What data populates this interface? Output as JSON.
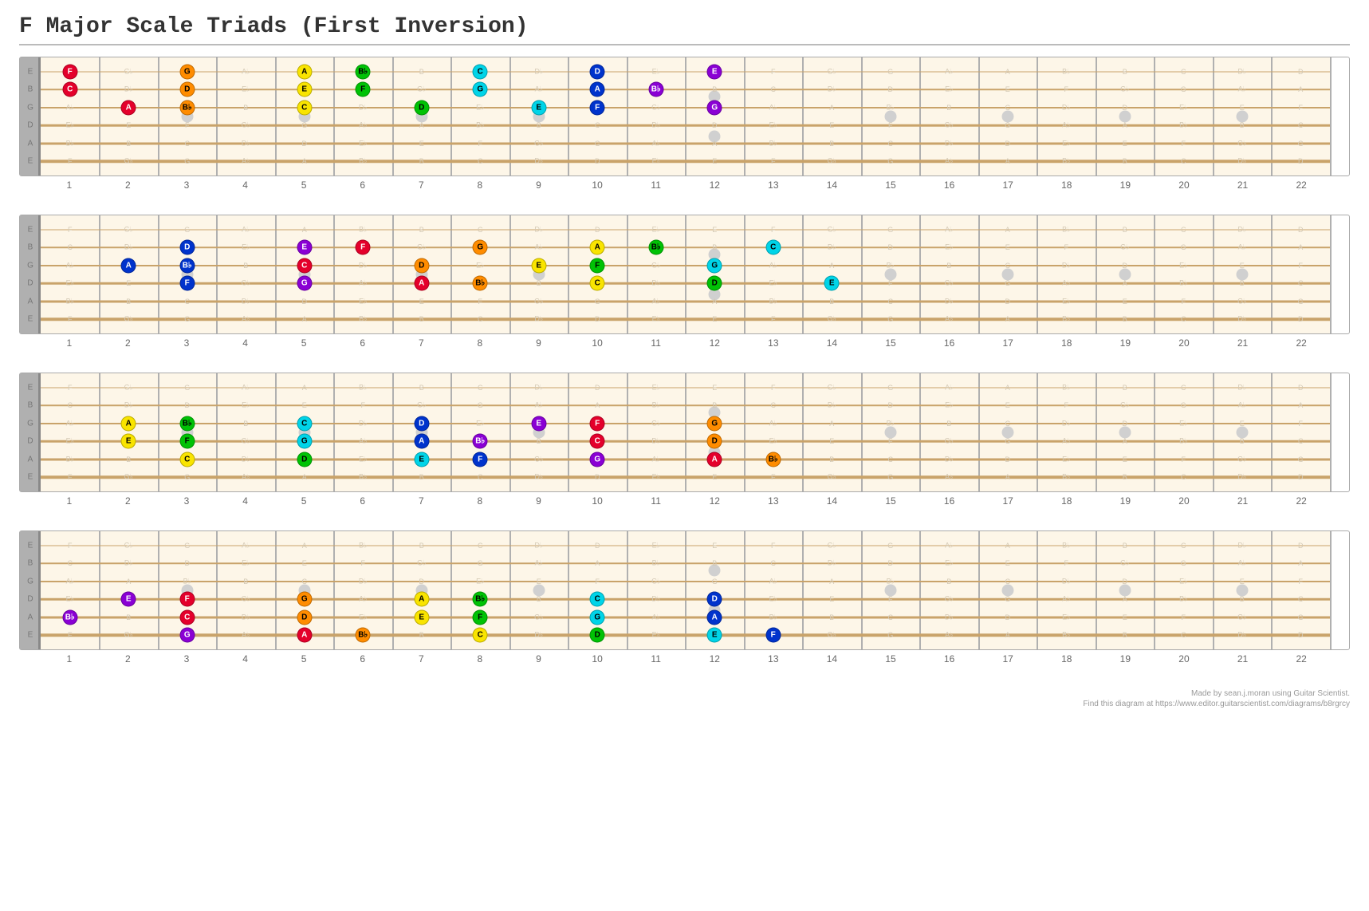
{
  "title": "F Major Scale Triads (First Inversion)",
  "credits_line1": "Made by sean.j.moran using Guitar Scientist.",
  "credits_line2": "Find this diagram at https://www.editor.guitarscientist.com/diagrams/b8rgrcy",
  "frets": 22,
  "tuning": [
    "E",
    "B",
    "G",
    "D",
    "A",
    "E"
  ],
  "inlays_single": [
    3,
    5,
    7,
    9,
    15,
    17,
    19,
    21
  ],
  "inlays_double": [
    12
  ],
  "colors": {
    "red": "#e4002b",
    "orange": "#ff8c00",
    "yellow": "#f9e400",
    "green": "#00c205",
    "cyan": "#00d4e8",
    "blue": "#0033cc",
    "purple": "#8a00d4"
  },
  "chromatic": [
    "A",
    "B♭",
    "B",
    "C",
    "D♭",
    "D",
    "E♭",
    "E",
    "F",
    "G♭",
    "G",
    "A♭"
  ],
  "open_notes": [
    "E",
    "A",
    "D",
    "G",
    "B",
    "E"
  ],
  "chart_data": [
    {
      "id": "board1",
      "notes": [
        {
          "string": 1,
          "fret": 1,
          "label": "F",
          "color": "red"
        },
        {
          "string": 2,
          "fret": 1,
          "label": "C",
          "color": "red"
        },
        {
          "string": 3,
          "fret": 2,
          "label": "A",
          "color": "red"
        },
        {
          "string": 1,
          "fret": 3,
          "label": "G",
          "color": "orange"
        },
        {
          "string": 2,
          "fret": 3,
          "label": "D",
          "color": "orange"
        },
        {
          "string": 3,
          "fret": 3,
          "label": "B♭",
          "color": "orange"
        },
        {
          "string": 1,
          "fret": 5,
          "label": "A",
          "color": "yellow"
        },
        {
          "string": 2,
          "fret": 5,
          "label": "E",
          "color": "yellow"
        },
        {
          "string": 3,
          "fret": 5,
          "label": "C",
          "color": "yellow"
        },
        {
          "string": 1,
          "fret": 6,
          "label": "B♭",
          "color": "green"
        },
        {
          "string": 2,
          "fret": 6,
          "label": "F",
          "color": "green"
        },
        {
          "string": 3,
          "fret": 7,
          "label": "D",
          "color": "green"
        },
        {
          "string": 1,
          "fret": 8,
          "label": "C",
          "color": "cyan"
        },
        {
          "string": 2,
          "fret": 8,
          "label": "G",
          "color": "cyan"
        },
        {
          "string": 3,
          "fret": 9,
          "label": "E",
          "color": "cyan"
        },
        {
          "string": 1,
          "fret": 10,
          "label": "D",
          "color": "blue"
        },
        {
          "string": 2,
          "fret": 10,
          "label": "A",
          "color": "blue"
        },
        {
          "string": 3,
          "fret": 10,
          "label": "F",
          "color": "blue"
        },
        {
          "string": 1,
          "fret": 12,
          "label": "E",
          "color": "purple"
        },
        {
          "string": 2,
          "fret": 11,
          "label": "B♭",
          "color": "purple"
        },
        {
          "string": 3,
          "fret": 12,
          "label": "G",
          "color": "purple"
        }
      ]
    },
    {
      "id": "board2",
      "notes": [
        {
          "string": 3,
          "fret": 2,
          "label": "A",
          "color": "blue"
        },
        {
          "string": 2,
          "fret": 3,
          "label": "D",
          "color": "blue"
        },
        {
          "string": 3,
          "fret": 3,
          "label": "B♭",
          "color": "blue"
        },
        {
          "string": 4,
          "fret": 3,
          "label": "F",
          "color": "blue"
        },
        {
          "string": 2,
          "fret": 5,
          "label": "E",
          "color": "purple"
        },
        {
          "string": 3,
          "fret": 5,
          "label": "C",
          "color": "red"
        },
        {
          "string": 4,
          "fret": 5,
          "label": "G",
          "color": "purple"
        },
        {
          "string": 2,
          "fret": 6,
          "label": "F",
          "color": "red"
        },
        {
          "string": 3,
          "fret": 7,
          "label": "D",
          "color": "orange"
        },
        {
          "string": 4,
          "fret": 7,
          "label": "A",
          "color": "red"
        },
        {
          "string": 2,
          "fret": 8,
          "label": "G",
          "color": "orange"
        },
        {
          "string": 4,
          "fret": 8,
          "label": "B♭",
          "color": "orange"
        },
        {
          "string": 3,
          "fret": 9,
          "label": "E",
          "color": "yellow"
        },
        {
          "string": 2,
          "fret": 10,
          "label": "A",
          "color": "yellow"
        },
        {
          "string": 3,
          "fret": 10,
          "label": "F",
          "color": "green"
        },
        {
          "string": 4,
          "fret": 10,
          "label": "C",
          "color": "yellow"
        },
        {
          "string": 2,
          "fret": 11,
          "label": "B♭",
          "color": "green"
        },
        {
          "string": 3,
          "fret": 12,
          "label": "G",
          "color": "cyan"
        },
        {
          "string": 4,
          "fret": 12,
          "label": "D",
          "color": "green"
        },
        {
          "string": 2,
          "fret": 13,
          "label": "C",
          "color": "cyan"
        },
        {
          "string": 4,
          "fret": 14,
          "label": "E",
          "color": "cyan"
        }
      ]
    },
    {
      "id": "board3",
      "notes": [
        {
          "string": 3,
          "fret": 2,
          "label": "A",
          "color": "yellow"
        },
        {
          "string": 4,
          "fret": 2,
          "label": "E",
          "color": "yellow"
        },
        {
          "string": 3,
          "fret": 3,
          "label": "B♭",
          "color": "green"
        },
        {
          "string": 4,
          "fret": 3,
          "label": "F",
          "color": "green"
        },
        {
          "string": 5,
          "fret": 3,
          "label": "C",
          "color": "yellow"
        },
        {
          "string": 3,
          "fret": 5,
          "label": "C",
          "color": "cyan"
        },
        {
          "string": 4,
          "fret": 5,
          "label": "G",
          "color": "cyan"
        },
        {
          "string": 5,
          "fret": 5,
          "label": "D",
          "color": "green"
        },
        {
          "string": 3,
          "fret": 7,
          "label": "D",
          "color": "blue"
        },
        {
          "string": 4,
          "fret": 7,
          "label": "A",
          "color": "blue"
        },
        {
          "string": 5,
          "fret": 7,
          "label": "E",
          "color": "cyan"
        },
        {
          "string": 4,
          "fret": 8,
          "label": "B♭",
          "color": "purple"
        },
        {
          "string": 5,
          "fret": 8,
          "label": "F",
          "color": "blue"
        },
        {
          "string": 3,
          "fret": 9,
          "label": "E",
          "color": "purple"
        },
        {
          "string": 3,
          "fret": 10,
          "label": "F",
          "color": "red"
        },
        {
          "string": 4,
          "fret": 10,
          "label": "C",
          "color": "red"
        },
        {
          "string": 5,
          "fret": 10,
          "label": "G",
          "color": "purple"
        },
        {
          "string": 3,
          "fret": 12,
          "label": "G",
          "color": "orange"
        },
        {
          "string": 4,
          "fret": 12,
          "label": "D",
          "color": "orange"
        },
        {
          "string": 5,
          "fret": 12,
          "label": "A",
          "color": "red"
        },
        {
          "string": 5,
          "fret": 13,
          "label": "B♭",
          "color": "orange"
        }
      ]
    },
    {
      "id": "board4",
      "notes": [
        {
          "string": 5,
          "fret": 1,
          "label": "B♭",
          "color": "purple"
        },
        {
          "string": 4,
          "fret": 2,
          "label": "E",
          "color": "purple"
        },
        {
          "string": 4,
          "fret": 3,
          "label": "F",
          "color": "red"
        },
        {
          "string": 5,
          "fret": 3,
          "label": "C",
          "color": "red"
        },
        {
          "string": 6,
          "fret": 3,
          "label": "G",
          "color": "purple"
        },
        {
          "string": 4,
          "fret": 5,
          "label": "G",
          "color": "orange"
        },
        {
          "string": 5,
          "fret": 5,
          "label": "D",
          "color": "orange"
        },
        {
          "string": 6,
          "fret": 5,
          "label": "A",
          "color": "red"
        },
        {
          "string": 6,
          "fret": 6,
          "label": "B♭",
          "color": "orange"
        },
        {
          "string": 4,
          "fret": 7,
          "label": "A",
          "color": "yellow"
        },
        {
          "string": 5,
          "fret": 7,
          "label": "E",
          "color": "yellow"
        },
        {
          "string": 4,
          "fret": 8,
          "label": "B♭",
          "color": "green"
        },
        {
          "string": 5,
          "fret": 8,
          "label": "F",
          "color": "green"
        },
        {
          "string": 6,
          "fret": 8,
          "label": "C",
          "color": "yellow"
        },
        {
          "string": 4,
          "fret": 10,
          "label": "C",
          "color": "cyan"
        },
        {
          "string": 5,
          "fret": 10,
          "label": "G",
          "color": "cyan"
        },
        {
          "string": 6,
          "fret": 10,
          "label": "D",
          "color": "green"
        },
        {
          "string": 4,
          "fret": 12,
          "label": "D",
          "color": "blue"
        },
        {
          "string": 5,
          "fret": 12,
          "label": "A",
          "color": "blue"
        },
        {
          "string": 6,
          "fret": 12,
          "label": "E",
          "color": "cyan"
        },
        {
          "string": 6,
          "fret": 13,
          "label": "F",
          "color": "blue"
        }
      ]
    }
  ]
}
